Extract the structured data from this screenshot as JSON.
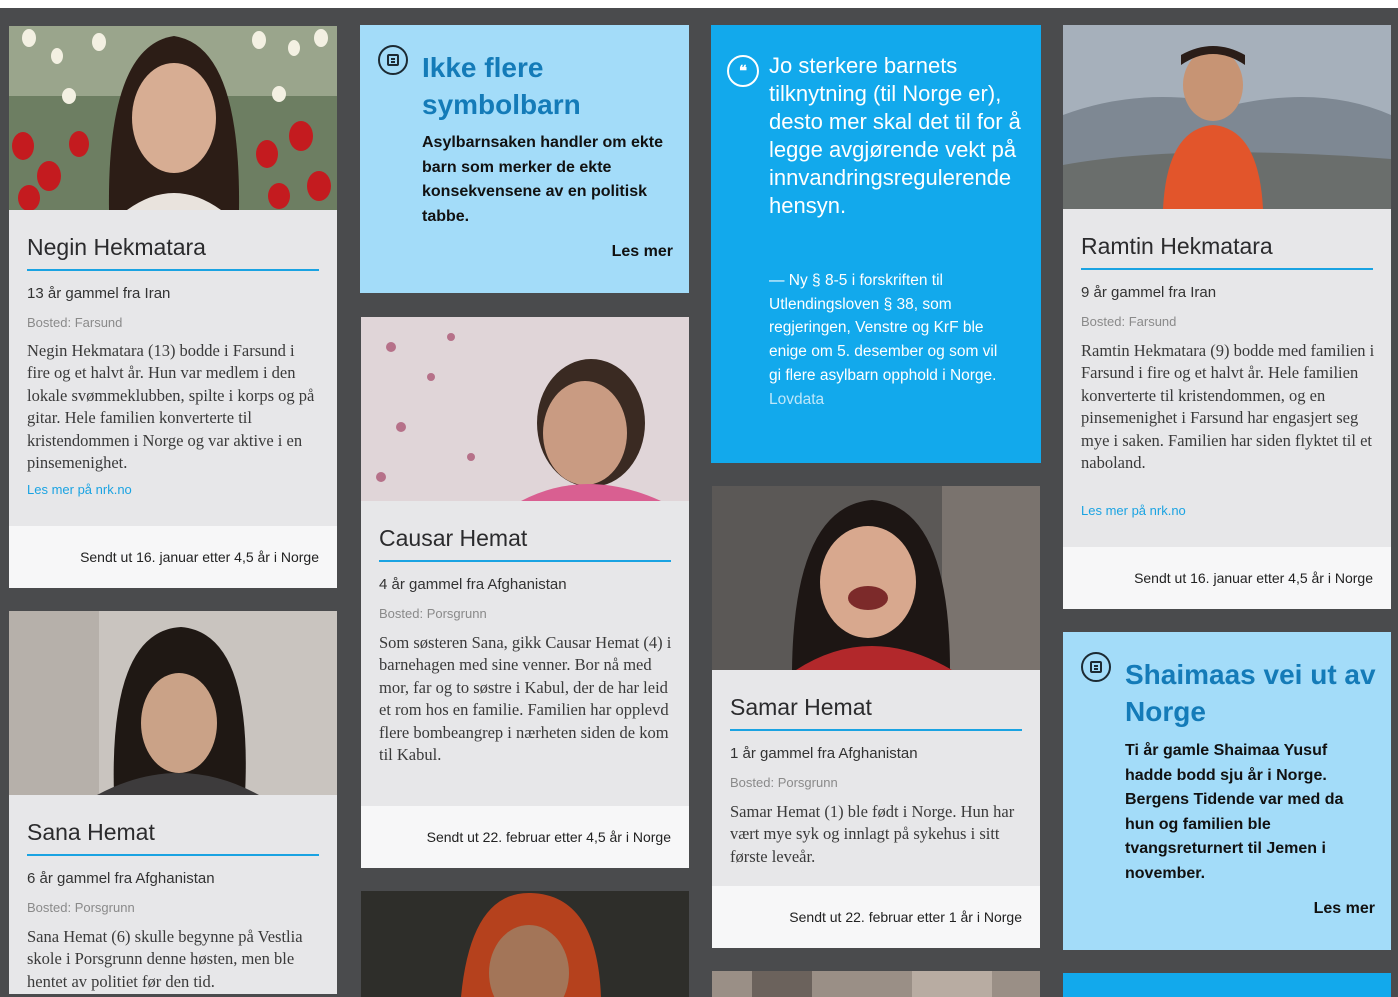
{
  "people": [
    {
      "name": "Negin Hekmatara",
      "age": "13 år gammel fra Iran",
      "home": "Bosted: Farsund",
      "bio": "Negin Hekmatara (13) bodde i Farsund i fire og et halvt år. Hun var medlem i den lokale svømmeklubben, spilte i korps og på gitar. Hele familien konverterte til kristendommen i Norge og var aktive i en pinsemenighet.",
      "link": "Les mer på nrk.no",
      "footer": "Sendt ut 16. januar etter 4,5 år i Norge"
    },
    {
      "name": "Sana Hemat",
      "age": "6 år gammel fra Afghanistan",
      "home": "Bosted: Porsgrunn",
      "bio": "Sana Hemat (6) skulle begynne på Vestlia skole i Porsgrunn denne høsten, men ble hentet av politiet før den tid."
    },
    {
      "name": "Causar Hemat",
      "age": "4 år gammel fra Afghanistan",
      "home": "Bosted: Porsgrunn",
      "bio": "Som søsteren Sana, gikk Causar Hemat (4) i barnehagen med sine venner. Bor nå med mor, far og to søstre i Kabul, der de har leid et rom hos en familie. Familien har opplevd flere bombeangrep i nærheten siden de kom til Kabul.",
      "footer": "Sendt ut 22. februar etter 4,5 år i Norge"
    },
    {
      "name": "Samar Hemat",
      "age": "1 år gammel fra Afghanistan",
      "home": "Bosted: Porsgrunn",
      "bio": "Samar Hemat (1) ble født i Norge. Hun har vært mye syk og innlagt på sykehus i sitt første leveår.",
      "footer": "Sendt ut 22. februar etter 1 år i Norge"
    },
    {
      "name": "Ramtin Hekmatara",
      "age": "9 år gammel fra Iran",
      "home": "Bosted: Farsund",
      "bio": "Ramtin Hekmatara (9) bodde med familien i Farsund i fire og et halvt år. Hele familien konverterte til kristendommen, og en pinsemenighet i Farsund har engasjert seg mye i saken. Familien har siden flyktet til et naboland.",
      "link": "Les mer på nrk.no",
      "footer": "Sendt ut 16. januar etter 4,5 år i Norge"
    }
  ],
  "articles": [
    {
      "icon": "article-icon",
      "title": "Ikke flere symbolbarn",
      "lead": "Asylbarnsaken handler om ekte barn som merker de ekte konsekvensene av en politisk tabbe.",
      "more": "Les mer"
    },
    {
      "icon": "article-icon",
      "title": "Shaimaas vei ut av Norge",
      "lead": "Ti år gamle Shaimaa Yusuf hadde bodd sju år i Norge. Bergens Tidende var med da hun og familien ble tvangsreturnert til Jemen i november.",
      "more": "Les mer"
    }
  ],
  "quote": {
    "icon": "quote-icon",
    "glyph": "❝",
    "text": "Jo sterkere barnets tilknytning (til Norge er), desto mer skal det til for å legge avgjørende vekt på innvandringsregulerende hensyn.",
    "source": "— Ny § 8-5 i forskriften til Utlendingsloven § 38, som regjeringen, Venstre og KrF ble enige om 5. desember og som vil gi flere asylbarn opphold i Norge.",
    "source_link": "Lovdata"
  },
  "colors": {
    "accent": "#1aa3e2",
    "article_bg": "#a3dcf9",
    "article_title": "#147bb8",
    "quote_bg": "#12a9ec",
    "card_bg": "#e7e7e9",
    "page_bg": "#4a4b4d"
  }
}
